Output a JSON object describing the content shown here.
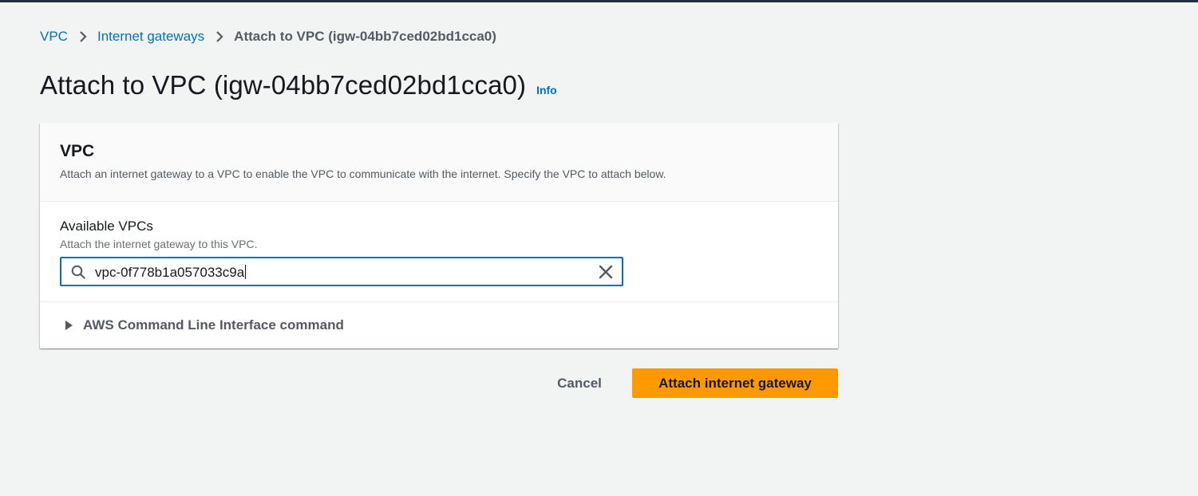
{
  "breadcrumb": {
    "items": [
      "VPC",
      "Internet gateways"
    ],
    "current": "Attach to VPC (igw-04bb7ced02bd1cca0)"
  },
  "page": {
    "title": "Attach to VPC (igw-04bb7ced02bd1cca0)",
    "info_link": "Info"
  },
  "panel": {
    "title": "VPC",
    "description": "Attach an internet gateway to a VPC to enable the VPC to communicate with the internet. Specify the VPC to attach below.",
    "field": {
      "label": "Available VPCs",
      "description": "Attach the internet gateway to this VPC.",
      "value": "vpc-0f778b1a057033c9a"
    },
    "expander_label": "AWS Command Line Interface command"
  },
  "actions": {
    "cancel_label": "Cancel",
    "primary_label": "Attach internet gateway"
  },
  "colors": {
    "link": "#0073bb",
    "primary_button": "#ff9900",
    "focus_border": "#0073bb"
  },
  "icons": [
    "chevron-right-icon",
    "search-icon",
    "close-icon",
    "caret-right-icon"
  ]
}
